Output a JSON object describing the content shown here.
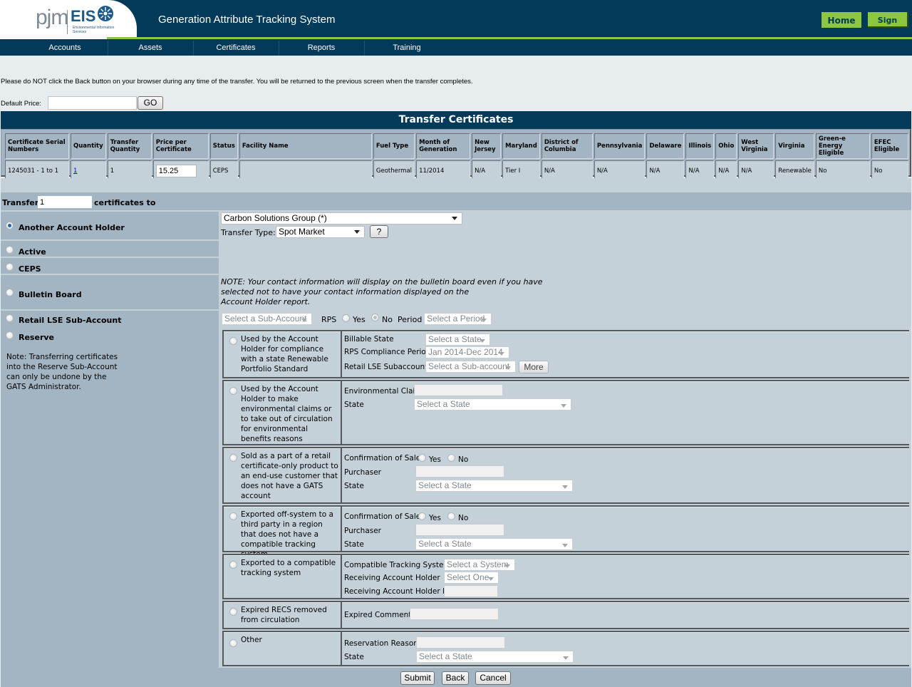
{
  "header": {
    "logo": {
      "brand": "pjm",
      "product": "EIS",
      "subtitle": "Environmental Information Services"
    },
    "title": "Generation Attribute Tracking System",
    "home_label": "Home",
    "signout_label": "Sign Out",
    "accent_color": "#8dc63f",
    "brand_color": "#033a5a"
  },
  "nav": {
    "items": [
      {
        "label": "Accounts"
      },
      {
        "label": "Assets"
      },
      {
        "label": "Certificates"
      },
      {
        "label": "Reports"
      },
      {
        "label": "Training"
      }
    ]
  },
  "notice": "Please do NOT click the Back button on your browser during any time of the transfer. You will be returned to the previous screen when the transfer completes.",
  "default_price": {
    "label": "Default Price:",
    "value": "",
    "go_label": "GO"
  },
  "certificates": {
    "title": "Transfer Certificates",
    "columns": [
      "Certificate Serial Numbers",
      "Quantity",
      "Transfer Quantity",
      "Price per Certificate",
      "Status",
      "Facility Name",
      "Fuel Type",
      "Month of Generation",
      "New Jersey",
      "Maryland",
      "District of Columbia",
      "Pennsylvania",
      "Delaware",
      "Illinois",
      "Ohio",
      "West Virginia",
      "Virginia",
      "Green-e Energy Eligible",
      "EFEC Eligible"
    ],
    "rows": [
      {
        "serial": "1245031 - 1 to 1",
        "quantity": "1",
        "transfer_quantity": "1",
        "price": "15.25",
        "status": "CEPS",
        "facility": "",
        "fuel_type": "Geothermal",
        "month": "11/2014",
        "new_jersey": "N/A",
        "maryland": "Tier I",
        "dc": "N/A",
        "pennsylvania": "N/A",
        "delaware": "N/A",
        "illinois": "N/A",
        "ohio": "N/A",
        "west_virginia": "N/A",
        "virginia": "Renewable",
        "greene": "No",
        "efec": "No"
      }
    ]
  },
  "transfer": {
    "label_before": "Transfer",
    "quantity": "1",
    "label_after": "certificates to",
    "options": {
      "another_account_holder": {
        "label": "Another Account Holder",
        "selected": true,
        "account_select": "Carbon Solutions Group (*)",
        "transfer_type_label": "Transfer Type:",
        "transfer_type": "Spot Market",
        "help_label": "?"
      },
      "active": {
        "label": "Active",
        "selected": false
      },
      "ceps": {
        "label": "CEPS",
        "selected": false
      },
      "bulletin_board": {
        "label": "Bulletin Board",
        "selected": false,
        "note_lines": [
          "NOTE: Your contact information will display on the bulletin board even if you have",
          "selected not to have your contact information displayed on the",
          "Account Holder report."
        ]
      },
      "retail_lse": {
        "label": "Retail LSE Sub-Account",
        "selected": false,
        "subaccount_placeholder": "Select a Sub-Account",
        "rps_label": "RPS",
        "rps_yes": "Yes",
        "rps_no": "No",
        "rps_value": "No",
        "period_label": "Period",
        "period_placeholder": "Select a Period"
      },
      "reserve": {
        "label": "Reserve",
        "selected": false,
        "note": "Note: Transferring certificates into the Reserve Sub-Account can only be undone by the GATS Administrator.",
        "reasons": [
          {
            "desc": "Used by the Account Holder for compliance with a state Renewable Portfolio Standard",
            "billable_state_label": "Billable State",
            "billable_state": "Select a State",
            "rps_period_label": "RPS Compliance Period",
            "rps_period": "Jan 2014-Dec 2014",
            "retail_sub_label": "Retail LSE Subaccount",
            "retail_sub": "Select a Sub-account",
            "more_label": "More"
          },
          {
            "desc": "Used by the Account Holder to make environmental claims or to take out of circulation for environmental benefits reasons",
            "claim_label": "Environmental Claim",
            "claim_value": "",
            "state_label": "State",
            "state": "Select a State"
          },
          {
            "desc": "Sold as a part of a retail certificate-only product to an end-use customer that does not have a GATS account",
            "conf_label": "Confirmation of Sale",
            "yes": "Yes",
            "no": "No",
            "purchaser_label": "Purchaser",
            "purchaser_value": "",
            "state_label": "State",
            "state": "Select a State"
          },
          {
            "desc": "Exported off-system to a third party in a region that does not have a compatible tracking system",
            "conf_label": "Confirmation of Sale",
            "yes": "Yes",
            "no": "No",
            "purchaser_label": "Purchaser",
            "purchaser_value": "",
            "state_label": "State",
            "state": "Select a State"
          },
          {
            "desc": "Exported to a compatible tracking system",
            "system_label": "Compatible Tracking System",
            "system": "Select a System",
            "holder_label": "Receiving Account Holder",
            "holder": "Select One",
            "holder_id_label": "Receiving Account Holder ID",
            "holder_id_value": ""
          },
          {
            "desc": "Expired RECS removed from circulation",
            "comments_label": "Expired Comments",
            "comments_value": ""
          },
          {
            "desc": "Other",
            "reason_label": "Reservation Reason",
            "reason_value": "",
            "state_label": "State",
            "state": "Select a State"
          }
        ]
      }
    }
  },
  "actions": {
    "submit": "Submit",
    "back": "Back",
    "cancel": "Cancel"
  }
}
